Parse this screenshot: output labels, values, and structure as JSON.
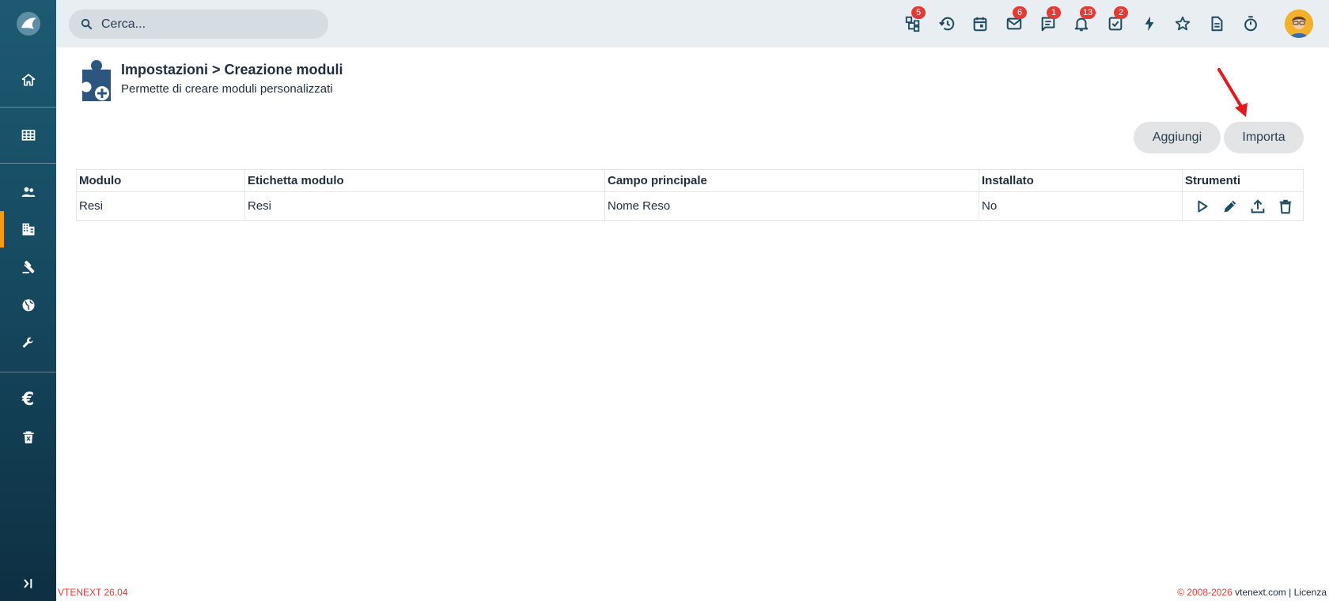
{
  "app": {
    "version": "VTENEXT 26.04"
  },
  "sidebar": {
    "items": [
      {
        "icon": "home-icon"
      },
      {
        "icon": "grid-icon"
      },
      {
        "icon": "contacts-icon"
      },
      {
        "icon": "building-icon",
        "active": true
      },
      {
        "icon": "gavel-icon"
      },
      {
        "icon": "globe-icon"
      },
      {
        "icon": "wrench-icon"
      },
      {
        "icon": "euro-icon",
        "glyph": "€"
      },
      {
        "icon": "trash-can-icon"
      },
      {
        "icon": "expand-sidebar-icon"
      }
    ]
  },
  "header": {
    "search": {
      "placeholder": "Cerca..."
    },
    "icons": [
      {
        "name": "hierarchy-icon",
        "badge": "5"
      },
      {
        "name": "history-icon",
        "badge": ""
      },
      {
        "name": "calendar-icon",
        "badge": ""
      },
      {
        "name": "mail-icon",
        "badge": "6"
      },
      {
        "name": "chat-icon",
        "badge": "1"
      },
      {
        "name": "bell-icon",
        "badge": "13"
      },
      {
        "name": "tasks-icon",
        "badge": "2"
      },
      {
        "name": "bolt-icon",
        "badge": ""
      },
      {
        "name": "star-icon",
        "badge": ""
      },
      {
        "name": "document-icon",
        "badge": ""
      },
      {
        "name": "timer-icon",
        "badge": ""
      }
    ]
  },
  "page": {
    "title": "Impostazioni > Creazione moduli",
    "subtitle": "Permette di creare moduli personalizzati",
    "buttons": {
      "add": "Aggiungi",
      "import": "Importa"
    }
  },
  "table": {
    "headers": [
      "Modulo",
      "Etichetta modulo",
      "Campo principale",
      "Installato",
      "Strumenti"
    ],
    "rows": [
      {
        "modulo": "Resi",
        "etichetta": "Resi",
        "campo": "Nome Reso",
        "installato": "No"
      }
    ]
  },
  "footer": {
    "copyright": "© 2008-2026",
    "site": "vtenext.com",
    "separator": "|",
    "license": "Licenza"
  },
  "colors": {
    "accent": "#f39c12",
    "badge": "#e53935",
    "sidebar": "#164a61",
    "icon": "#1e4a62"
  }
}
